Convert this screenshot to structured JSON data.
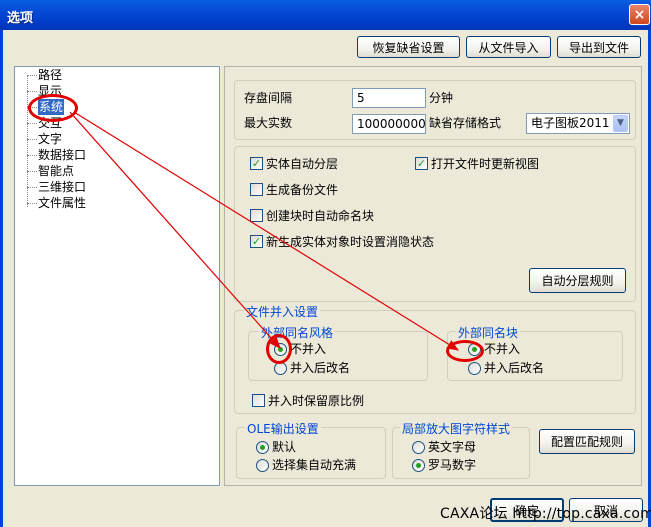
{
  "window": {
    "title": "选项",
    "close_glyph": "×"
  },
  "top_buttons": {
    "restore": "恢复缺省设置",
    "import": "从文件导入",
    "export": "导出到文件"
  },
  "tree": {
    "items": [
      {
        "label": "路径"
      },
      {
        "label": "显示"
      },
      {
        "label": "系统",
        "selected": true
      },
      {
        "label": "交互"
      },
      {
        "label": "文字"
      },
      {
        "label": "数据接口"
      },
      {
        "label": "智能点"
      },
      {
        "label": "三维接口"
      },
      {
        "label": "文件属性"
      }
    ]
  },
  "settings": {
    "save_interval_label": "存盘间隔",
    "save_interval_value": "5",
    "save_interval_unit": "分钟",
    "max_entities_label": "最大实数",
    "max_entities_value": "100000000",
    "default_format_label": "缺省存储格式",
    "default_format_value": "电子图板2011"
  },
  "options": {
    "auto_layer": {
      "label": "实体自动分层",
      "checked": true
    },
    "update_view_on_open": {
      "label": "打开文件时更新视图",
      "checked": true
    },
    "backup_file": {
      "label": "生成备份文件",
      "checked": false
    },
    "auto_name_block": {
      "label": "创建块时自动命名块",
      "checked": false
    },
    "hidden_state": {
      "label": "新生成实体对象时设置消隐状态",
      "checked": true
    },
    "auto_layer_rules_button": "自动分层规则"
  },
  "file_merge": {
    "title": "文件并入设置",
    "style_group": {
      "title": "外部同名风格",
      "option_no_merge": "不并入",
      "option_rename": "并入后改名",
      "selected": "不并入"
    },
    "block_group": {
      "title": "外部同名块",
      "option_no_merge": "不并入",
      "option_rename": "并入后改名",
      "selected": "不并入"
    },
    "keep_scale": {
      "label": "并入时保留原比例",
      "checked": false
    }
  },
  "ole": {
    "title": "OLE输出设置",
    "option_default": "默认",
    "option_fill": "选择集自动充满",
    "selected": "默认"
  },
  "zoom_font": {
    "title": "局部放大图字符样式",
    "option_letters": "英文字母",
    "option_roman": "罗马数字",
    "selected": "罗马数字"
  },
  "match_rules_button": "配置匹配规则",
  "dialog_buttons": {
    "ok": "确定",
    "cancel": "取消"
  },
  "watermark": "CAXA论坛 http://top.caxa.com/",
  "annotation": {
    "color": "#e00000"
  }
}
